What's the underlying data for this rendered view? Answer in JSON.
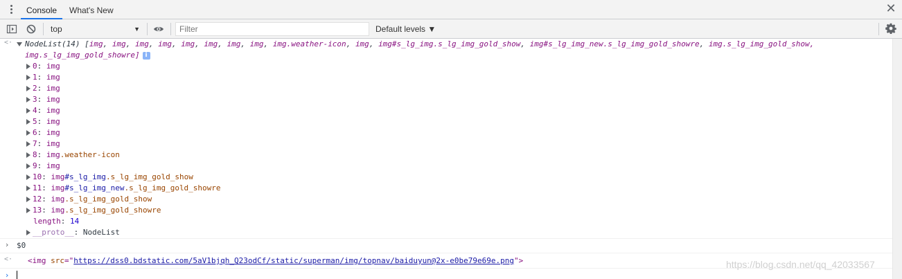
{
  "tabs": {
    "console": "Console",
    "whats_new": "What's New"
  },
  "toolbar": {
    "context": "top",
    "filter_placeholder": "Filter",
    "levels": "Default levels ▼"
  },
  "nodelist": {
    "header_prefix": "NodeList(14) [",
    "header_items": [
      {
        "text": "img",
        "kind": "tag"
      },
      {
        "text": "img",
        "kind": "tag"
      },
      {
        "text": "img",
        "kind": "tag"
      },
      {
        "text": "img",
        "kind": "tag"
      },
      {
        "text": "img",
        "kind": "tag"
      },
      {
        "text": "img",
        "kind": "tag"
      },
      {
        "text": "img",
        "kind": "tag"
      },
      {
        "text": "img",
        "kind": "tag"
      },
      {
        "text": "img.weather-icon",
        "kind": "mixed"
      },
      {
        "text": "img",
        "kind": "tag"
      },
      {
        "text": "img#s_lg_img.s_lg_img_gold_show",
        "kind": "mixed"
      },
      {
        "text": "img#s_lg_img_new.s_lg_img_gold_showre",
        "kind": "mixed"
      }
    ],
    "header_line2": "img.s_lg_img_gold_show,",
    "header_line3": "img.s_lg_img_gold_showre]",
    "items": [
      {
        "key": "0",
        "tag": "img",
        "id": "",
        "cls": ""
      },
      {
        "key": "1",
        "tag": "img",
        "id": "",
        "cls": ""
      },
      {
        "key": "2",
        "tag": "img",
        "id": "",
        "cls": ""
      },
      {
        "key": "3",
        "tag": "img",
        "id": "",
        "cls": ""
      },
      {
        "key": "4",
        "tag": "img",
        "id": "",
        "cls": ""
      },
      {
        "key": "5",
        "tag": "img",
        "id": "",
        "cls": ""
      },
      {
        "key": "6",
        "tag": "img",
        "id": "",
        "cls": ""
      },
      {
        "key": "7",
        "tag": "img",
        "id": "",
        "cls": ""
      },
      {
        "key": "8",
        "tag": "img",
        "id": "",
        "cls": ".weather-icon"
      },
      {
        "key": "9",
        "tag": "img",
        "id": "",
        "cls": ""
      },
      {
        "key": "10",
        "tag": "img",
        "id": "#s_lg_img",
        "cls": ".s_lg_img_gold_show"
      },
      {
        "key": "11",
        "tag": "img",
        "id": "#s_lg_img_new",
        "cls": ".s_lg_img_gold_showre"
      },
      {
        "key": "12",
        "tag": "img",
        "id": "",
        "cls": ".s_lg_img_gold_show"
      },
      {
        "key": "13",
        "tag": "img",
        "id": "",
        "cls": ".s_lg_img_gold_showre"
      }
    ],
    "length_key": "length",
    "length_val": "14",
    "proto_key": "__proto__",
    "proto_val": "NodeList"
  },
  "input_cmd": "$0",
  "result": {
    "open": "<img ",
    "attr": "src",
    "eq": "=\"",
    "url": "https://dss0.bdstatic.com/5aV1bjqh_Q23odCf/static/superman/img/topnav/baiduyun@2x-e0be79e69e.png",
    "close": "\">"
  },
  "watermark": "https://blog.csdn.net/qq_42033567"
}
